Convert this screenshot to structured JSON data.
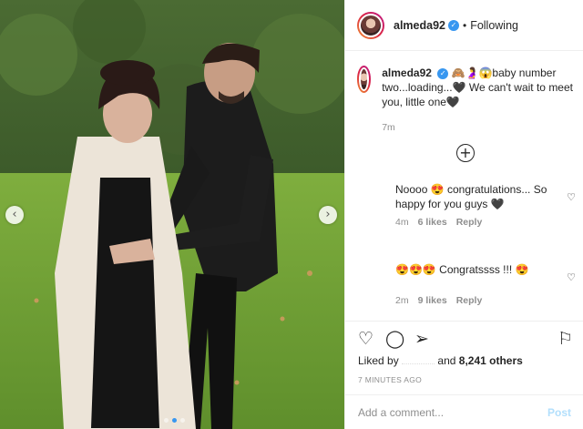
{
  "post": {
    "username": "almeda92",
    "follow_status": "Following",
    "separator": "•",
    "verified_glyph": "✓"
  },
  "caption": {
    "username": "almeda92",
    "text": "🙈🤰😱baby number two...loading...🖤 We can't wait to meet you, little one🖤",
    "time": "7m"
  },
  "load_more_glyph": "+",
  "comments": [
    {
      "username": "",
      "text": "Noooo 😍 congratulations... So happy for you guys 🖤",
      "time": "4m",
      "likes": "6 likes",
      "reply_label": "Reply"
    },
    {
      "username": "",
      "text": "😍😍😍 Congratssss !!! 😍",
      "time": "2m",
      "likes": "9 likes",
      "reply_label": "Reply"
    }
  ],
  "likes": {
    "prefix": "Liked by",
    "connector": "and",
    "count_text": "8,241 others"
  },
  "time_ago": "7 MINUTES AGO",
  "add_comment": {
    "placeholder": "Add a comment...",
    "post_label": "Post"
  },
  "icons": {
    "heart": "♡",
    "comment": "◯",
    "share": "➢",
    "save": "⚐",
    "prev": "‹",
    "next": "›"
  },
  "carousel": {
    "current_slide": 2,
    "total_slides": 3
  },
  "colors": {
    "verified": "#3897f0",
    "post_button_disabled": "#b2dffc",
    "muted_text": "#8e8e8e"
  }
}
